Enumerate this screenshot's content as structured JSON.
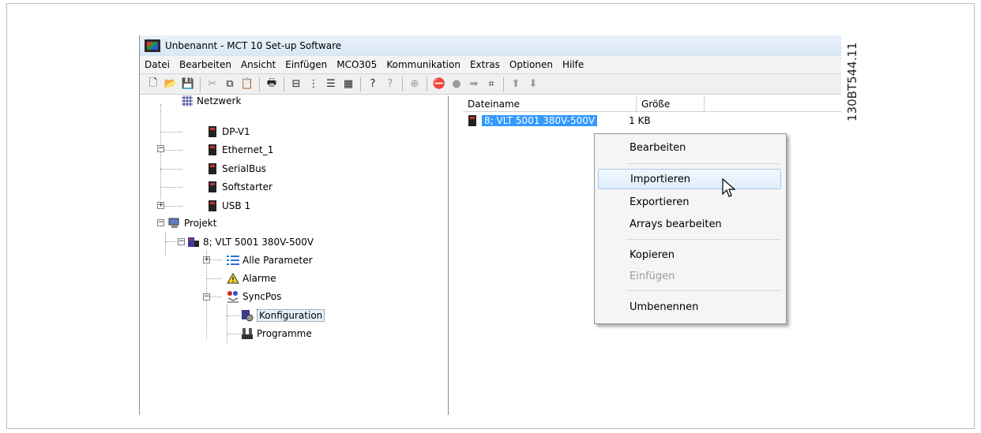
{
  "doc_id": "130BT544.11",
  "window": {
    "title": "Unbenannt - MCT 10 Set-up Software"
  },
  "menubar": [
    "Datei",
    "Bearbeiten",
    "Ansicht",
    "Einfügen",
    "MCO305",
    "Kommunikation",
    "Extras",
    "Optionen",
    "Hilfe"
  ],
  "tree": {
    "netzwerk": "Netzwerk",
    "dpv1": "DP-V1",
    "ethernet": "Ethernet_1",
    "serialbus": "SerialBus",
    "softstarter": "Softstarter",
    "usb": "USB 1",
    "projekt": "Projekt",
    "vlt": "8; VLT 5001 380V-500V",
    "alle_parameter": "Alle Parameter",
    "alarme": "Alarme",
    "syncpos": "SyncPos",
    "konfiguration": "Konfiguration",
    "programme": "Programme"
  },
  "list": {
    "col_name": "Dateiname",
    "col_size": "Größe",
    "row_name": "8; VLT 5001 380V-500V",
    "row_size": "1 KB"
  },
  "context_menu": {
    "bearbeiten": "Bearbeiten",
    "importieren": "Importieren",
    "exportieren": "Exportieren",
    "arrays": "Arrays bearbeiten",
    "kopieren": "Kopieren",
    "einfuegen": "Einfügen",
    "umbenennen": "Umbenennen"
  }
}
